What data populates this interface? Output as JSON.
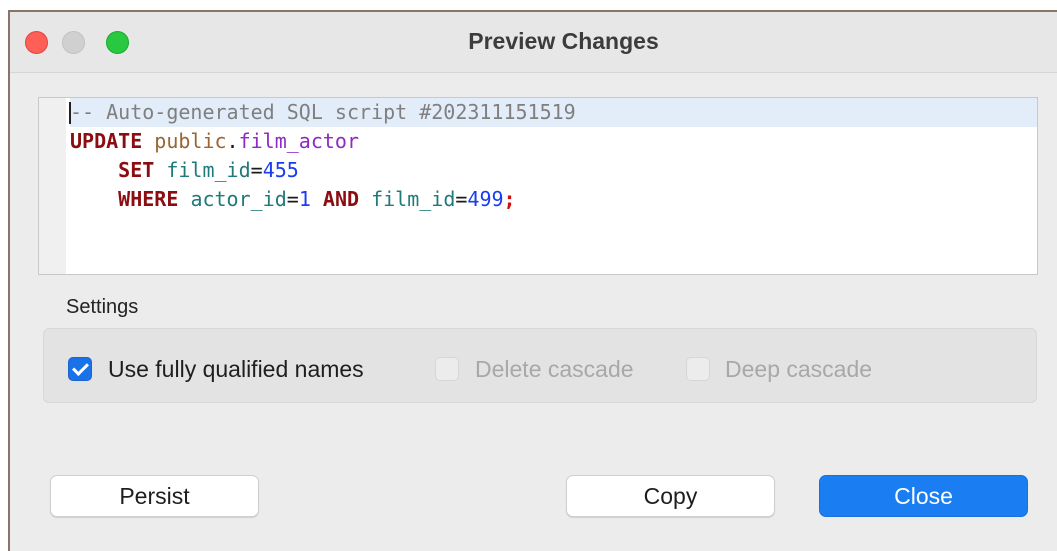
{
  "window": {
    "title": "Preview Changes"
  },
  "editor": {
    "comment": "-- Auto-generated SQL script #202311151519",
    "kw_update": "UPDATE",
    "schema": "public",
    "dot": ".",
    "table": "film_actor",
    "kw_set": "SET",
    "set_column": "film_id",
    "eq1": "=",
    "set_value": "455",
    "kw_where": "WHERE",
    "where_col1": "actor_id",
    "eq2": "=",
    "where_val1": "1",
    "kw_and": "AND",
    "where_col2": "film_id",
    "eq3": "=",
    "where_val2": "499",
    "semicolon": ";"
  },
  "settings": {
    "label": "Settings",
    "options": [
      {
        "label": "Use fully qualified names",
        "checked": true,
        "enabled": true
      },
      {
        "label": "Delete cascade",
        "checked": false,
        "enabled": false
      },
      {
        "label": "Deep cascade",
        "checked": false,
        "enabled": false
      }
    ]
  },
  "buttons": {
    "persist": "Persist",
    "copy": "Copy",
    "close": "Close"
  },
  "colors": {
    "keyword": "#8b0d12",
    "schema": "#996633",
    "table": "#8e2bc2",
    "column": "#207a7a",
    "number": "#1a3cf0",
    "comment": "#7f7f7f",
    "accent": "#1a7ef2"
  }
}
